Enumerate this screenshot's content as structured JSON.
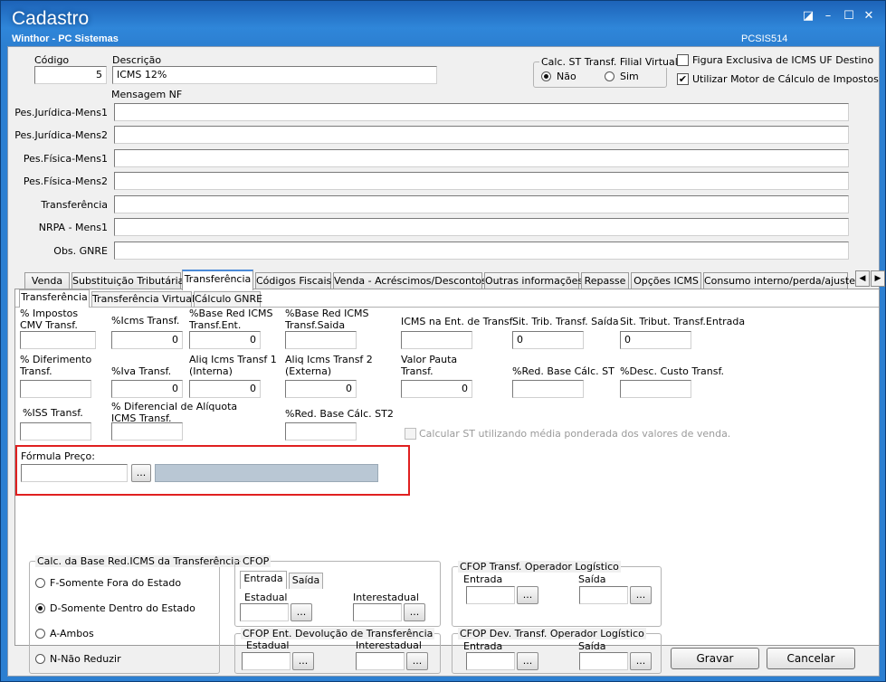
{
  "window": {
    "title": "Cadastro",
    "subtitle": "Winthor - PC Sistemas",
    "code": "PCSIS514",
    "controls": [
      "◪",
      "–",
      "☐",
      "✕"
    ]
  },
  "header": {
    "codigo_label": "Código",
    "codigo_value": "5",
    "descricao_label": "Descrição",
    "descricao_value": "ICMS 12%",
    "calc_st_group": "Calc. ST Transf. Filial Virtual",
    "radio_nao": "Não",
    "radio_sim": "Sim",
    "check_figura": "Figura Exclusiva de ICMS UF Destino",
    "check_motor": "Utilizar Motor de Cálculo de Impostos",
    "check_mark": "✔"
  },
  "mensagem": {
    "title": "Mensagem NF",
    "rows": [
      {
        "label": "Pes.Jurídica-Mens1",
        "value": ""
      },
      {
        "label": "Pes.Jurídica-Mens2",
        "value": ""
      },
      {
        "label": "Pes.Física-Mens1",
        "value": ""
      },
      {
        "label": "Pes.Física-Mens2",
        "value": ""
      },
      {
        "label": "Transferência",
        "value": ""
      },
      {
        "label": "NRPA - Mens1",
        "value": ""
      },
      {
        "label": "Obs. GNRE",
        "value": ""
      }
    ]
  },
  "tabs": [
    "Venda",
    "Substituição Tributária",
    "Transferência",
    "Códigos Fiscais",
    "Venda - Acréscimos/Descontos",
    "Outras informações",
    "Repasse",
    "Opções ICMS",
    "Consumo interno/perda/ajuste",
    "◀",
    "▶"
  ],
  "subtabs": [
    "Transferência",
    "Transferência Virtual",
    "Cálculo GNRE"
  ],
  "fields": {
    "impostos_cmv": "% Impostos\nCMV Transf.",
    "icms_transf": "%Icms Transf.",
    "icms_transf_value": "0",
    "base_red_ent": "%Base Red ICMS\nTransf.Ent.",
    "base_red_ent_value": "0",
    "base_red_saida": "%Base Red ICMS\nTransf.Saida",
    "icms_ent_dest": "ICMS na Ent. de Transf.",
    "sit_trib_saida": "Sit. Trib. Transf. Saída",
    "sit_trib_saida_value": "0",
    "sit_trib_entrada": "Sit. Tribut. Transf.Entrada",
    "sit_trib_entrada_value": "0",
    "diferimento": "% Diferimento\nTransf.",
    "iva_transf": "%Iva Transf.",
    "iva_transf_value": "0",
    "aliq_interna": "Aliq Icms Transf 1\n(Interna)",
    "aliq_interna_value": "0",
    "aliq_externa": "Aliq Icms Transf 2\n(Externa)",
    "aliq_externa_value": "0",
    "valor_pauta": "Valor Pauta\nTransf.",
    "valor_pauta_value": "0",
    "red_base_st": "%Red. Base Cálc. ST",
    "desc_custo": "%Desc. Custo Transf.",
    "iss_transf": "%ISS  Transf.",
    "dif_aliquota": "% Diferencial de Alíquota\nICMS Transf.",
    "red_base_st2": "%Red. Base Cálc. ST2",
    "calc_st_media": "Calcular ST utilizando média ponderada dos valores de venda.",
    "formula_preco": "Fórmula Preço:",
    "ellipsis": "..."
  },
  "calc_base": {
    "title": "Calc. da Base Red.ICMS da Transferência",
    "options": [
      "F-Somente Fora do Estado",
      "D-Somente Dentro do Estado",
      "A-Ambos",
      "N-Não Reduzir"
    ],
    "selected": 1
  },
  "cfop": {
    "title": "CFOP",
    "tab_entrada": "Entrada",
    "tab_saida": "Saída",
    "estadual": "Estadual",
    "interestadual": "Interestadual",
    "dev_title": "CFOP Ent. Devolução de Transferência",
    "op_log_title": "CFOP Transf. Operador Logístico",
    "entrada": "Entrada",
    "saida": "Saída",
    "op_log_dev_title": "CFOP Dev. Transf. Operador Logístico"
  },
  "footer": {
    "gravar": "Gravar",
    "cancelar": "Cancelar"
  },
  "colors": {
    "titlebar": "#2c7fd1",
    "highlight_box": "#e02020",
    "active_tab_top": "#4a8ad8"
  }
}
